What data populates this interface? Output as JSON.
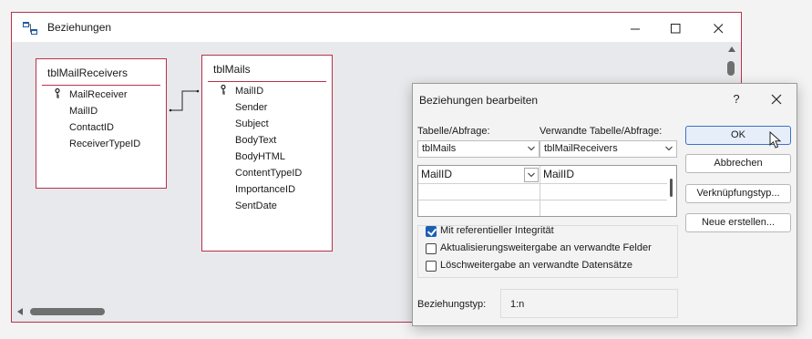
{
  "window": {
    "title": "Beziehungen",
    "controls": {
      "minimize": "—",
      "maximize": "☐",
      "close": "✕"
    }
  },
  "tables": [
    {
      "name": "tblMailReceivers",
      "fields": [
        {
          "label": "MailReceiver",
          "key": true
        },
        {
          "label": "MailID",
          "key": false
        },
        {
          "label": "ContactID",
          "key": false
        },
        {
          "label": "ReceiverTypeID",
          "key": false
        }
      ]
    },
    {
      "name": "tblMails",
      "fields": [
        {
          "label": "MailID",
          "key": true
        },
        {
          "label": "Sender",
          "key": false
        },
        {
          "label": "Subject",
          "key": false
        },
        {
          "label": "BodyText",
          "key": false
        },
        {
          "label": "BodyHTML",
          "key": false
        },
        {
          "label": "ContentTypeID",
          "key": false
        },
        {
          "label": "ImportanceID",
          "key": false
        },
        {
          "label": "SentDate",
          "key": false
        }
      ]
    }
  ],
  "dialog": {
    "title": "Beziehungen bearbeiten",
    "help": "?",
    "table_label": "Tabelle/Abfrage:",
    "related_label": "Verwandte Tabelle/Abfrage:",
    "table_value": "tblMails",
    "related_value": "tblMailReceivers",
    "grid_rows": [
      {
        "left": "MailID",
        "right": "MailID"
      },
      {
        "left": "",
        "right": ""
      },
      {
        "left": "",
        "right": ""
      }
    ],
    "integrity_label": "Mit referentieller Integrität",
    "integrity_checked": true,
    "cascade_update_label": "Aktualisierungsweitergabe an verwandte Felder",
    "cascade_update_checked": false,
    "cascade_delete_label": "Löschweitergabe an verwandte Datensätze",
    "cascade_delete_checked": false,
    "reltype_label": "Beziehungstyp:",
    "reltype_value": "1:n",
    "buttons": {
      "ok": "OK",
      "cancel": "Abbrechen",
      "join_type": "Verknüpfungstyp...",
      "create_new": "Neue erstellen..."
    }
  },
  "colors": {
    "accent_border": "#b8324a",
    "ok_highlight": "#3a73c9",
    "checkbox_on": "#1b5fb4"
  }
}
